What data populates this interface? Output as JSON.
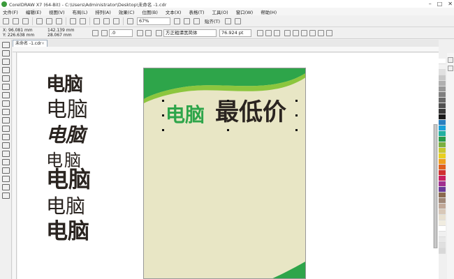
{
  "window": {
    "title": "CorelDRAW X7 (64-Bit) - C:\\Users\\Administrator\\Desktop\\未命名 -1.cdr"
  },
  "menu": [
    "文件(F)",
    "编辑(E)",
    "视图(V)",
    "布局(L)",
    "排列(A)",
    "效果(C)",
    "位图(B)",
    "文本(X)",
    "表格(T)",
    "工具(O)",
    "窗口(W)",
    "帮助(H)"
  ],
  "toolbar": {
    "zoom": "67%",
    "snap_label": "贴齐(T)"
  },
  "property_bar": {
    "x": "X: 96.081 mm",
    "y": "Y: 226.638 mm",
    "width": "142.139 mm",
    "height": "28.067 mm",
    "rotation": ".0",
    "font_name": "方正粗谭黑简体",
    "font_size": "76.924 pt"
  },
  "document_tab": {
    "name": "未命名 -1.cdr"
  },
  "samples": [
    {
      "text": "电脑"
    },
    {
      "text": "电脑"
    },
    {
      "text": "电脑"
    },
    {
      "text": "电脑"
    },
    {
      "text": "电脑"
    },
    {
      "text": "电脑"
    },
    {
      "text": "电脑"
    }
  ],
  "poster": {
    "heading_green": "电脑",
    "heading_dark": "最低价",
    "accent_color": "#2ea54a",
    "background_color": "#e8e6c5"
  },
  "palette": {
    "colors": [
      "#ffffff",
      "#f2f2f2",
      "#e0e0e0",
      "#c8c8c8",
      "#b0b0b0",
      "#989898",
      "#808080",
      "#686868",
      "#505050",
      "#383838",
      "#1a1a1a",
      "#2a7fc0",
      "#1aa0d8",
      "#22b0a0",
      "#2a9a4a",
      "#7ab040",
      "#c8c830",
      "#e8d020",
      "#f0a020",
      "#e06020",
      "#d03030",
      "#c82060",
      "#a03090",
      "#6a3a98",
      "#8a6a50",
      "#a08878",
      "#c0a898",
      "#d8c8b8",
      "#e8e0d0",
      "#f0ece0",
      "#ffffff",
      "#f0f0f0",
      "#e8e8e8",
      "#e0e0e0",
      "#d8d8d8"
    ]
  }
}
